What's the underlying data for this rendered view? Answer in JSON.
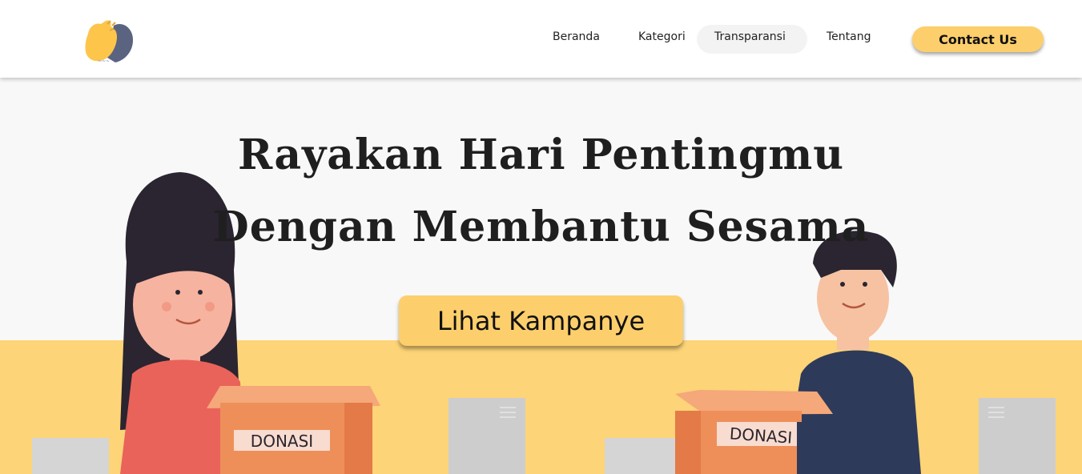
{
  "nav": {
    "items": [
      {
        "label": "Beranda"
      },
      {
        "label": "Kategori"
      },
      {
        "label": "Transparansi"
      },
      {
        "label": "Tentang"
      }
    ],
    "contact_label": "Contact Us"
  },
  "hero": {
    "title_line1": "Rayakan Hari Pentingmu",
    "title_line2": "Dengan Membantu Sesama",
    "cta_label": "Lihat Kampanye",
    "box_left_label": "DONASI",
    "box_right_label": "DONASI"
  },
  "colors": {
    "accent": "#fdcf6c",
    "hero_band": "#fdd477",
    "box": "#ee8f5a",
    "shirt_left": "#e9635a",
    "shirt_right": "#2e3a5a"
  },
  "icons": {
    "logo": "hands-logo"
  }
}
